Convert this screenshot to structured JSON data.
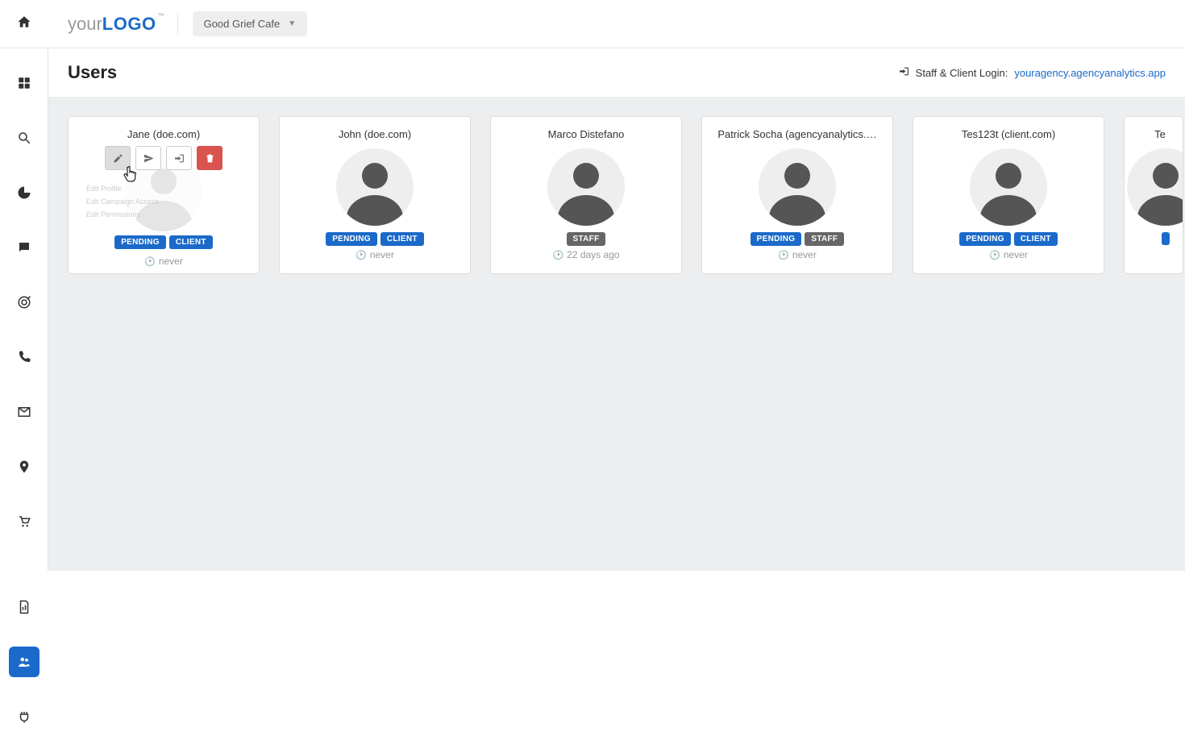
{
  "header": {
    "logo_prefix": "your",
    "logo_bold": "LOGO",
    "logo_tm": "™",
    "campaign": "Good Grief Cafe"
  },
  "page": {
    "title": "Users",
    "login_label": "Staff & Client Login:",
    "login_url": "youragency.agencyanalytics.app"
  },
  "hover_menu": {
    "item1": "Edit Profile",
    "item2": "Edit Campaign Access",
    "item3": "Edit Permissions"
  },
  "users": [
    {
      "name": "Jane (doe.com)",
      "badges": [
        {
          "text": "PENDING",
          "style": "blue"
        },
        {
          "text": "CLIENT",
          "style": "blue"
        }
      ],
      "time": "never",
      "hover": true
    },
    {
      "name": "John (doe.com)",
      "badges": [
        {
          "text": "PENDING",
          "style": "blue"
        },
        {
          "text": "CLIENT",
          "style": "blue"
        }
      ],
      "time": "never"
    },
    {
      "name": "Marco Distefano",
      "badges": [
        {
          "text": "STAFF",
          "style": "grey"
        }
      ],
      "time": "22 days ago"
    },
    {
      "name": "Patrick Socha (agencyanalytics.…",
      "badges": [
        {
          "text": "PENDING",
          "style": "blue"
        },
        {
          "text": "STAFF",
          "style": "grey"
        }
      ],
      "time": "never"
    },
    {
      "name": "Tes123t (client.com)",
      "badges": [
        {
          "text": "PENDING",
          "style": "blue"
        },
        {
          "text": "CLIENT",
          "style": "blue"
        }
      ],
      "time": "never"
    },
    {
      "name": "Te",
      "partial": true,
      "badges": [
        {
          "text": "",
          "style": "blue"
        }
      ],
      "time": ""
    }
  ]
}
